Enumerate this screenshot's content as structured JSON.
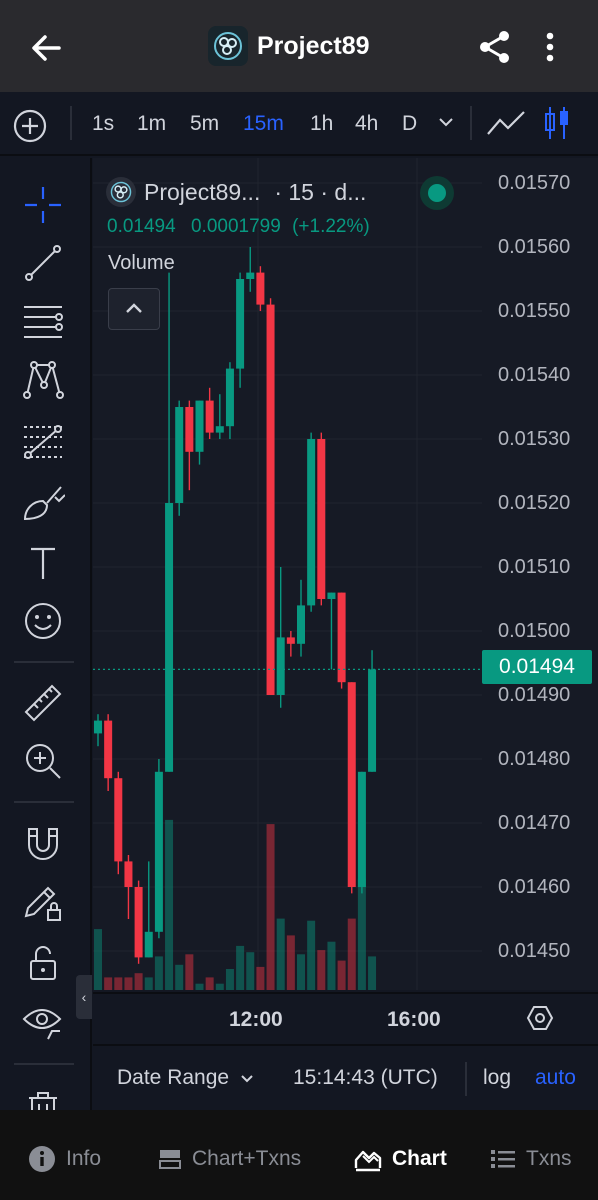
{
  "header": {
    "title": "Project89",
    "back_icon": "arrow-left-icon",
    "share_icon": "share-icon",
    "more_icon": "more-vertical-icon"
  },
  "timeframes": {
    "items": [
      "1s",
      "1m",
      "5m",
      "15m",
      "1h",
      "4h",
      "D"
    ],
    "active": "15m"
  },
  "legend": {
    "symbol": "Project89...",
    "meta": "· 15 · d...",
    "price": "0.01494",
    "change": "0.0001799",
    "change_pct": "(+1.22%)",
    "volume_label": "Volume"
  },
  "price_scale": {
    "labels": [
      "0.01570",
      "0.01560",
      "0.01550",
      "0.01540",
      "0.01530",
      "0.01520",
      "0.01510",
      "0.01500",
      "0.01490",
      "0.01480",
      "0.01470",
      "0.01460",
      "0.01450"
    ],
    "current": "0.01494"
  },
  "time_axis": {
    "labels": [
      "12:00",
      "16:00"
    ]
  },
  "range_bar": {
    "date_range": "Date Range",
    "clock": "15:14:43 (UTC)",
    "log": "log",
    "auto": "auto"
  },
  "bottom_nav": {
    "items": [
      {
        "label": "Info",
        "icon": "info-icon"
      },
      {
        "label": "Chart+Txns",
        "icon": "split-view-icon"
      },
      {
        "label": "Chart",
        "icon": "area-chart-icon"
      },
      {
        "label": "Txns",
        "icon": "list-icon"
      }
    ],
    "active": "Chart"
  },
  "colors": {
    "up": "#089981",
    "down": "#f23645",
    "accent": "#2962ff",
    "background": "#131722"
  },
  "chart_data": {
    "type": "candlestick",
    "ylim": [
      0.0144,
      0.01575
    ],
    "candles": [
      {
        "o": 0.01484,
        "h": 0.01487,
        "l": 0.01482,
        "c": 0.01486
      },
      {
        "o": 0.01486,
        "h": 0.01487,
        "l": 0.01475,
        "c": 0.01477
      },
      {
        "o": 0.01477,
        "h": 0.01478,
        "l": 0.01462,
        "c": 0.01464
      },
      {
        "o": 0.01464,
        "h": 0.01465,
        "l": 0.01455,
        "c": 0.0146
      },
      {
        "o": 0.0146,
        "h": 0.01461,
        "l": 0.01448,
        "c": 0.01449
      },
      {
        "o": 0.01449,
        "h": 0.01464,
        "l": 0.01449,
        "c": 0.01453
      },
      {
        "o": 0.01453,
        "h": 0.0148,
        "l": 0.01452,
        "c": 0.01478
      },
      {
        "o": 0.01478,
        "h": 0.01556,
        "l": 0.01478,
        "c": 0.0152
      },
      {
        "o": 0.0152,
        "h": 0.01536,
        "l": 0.01518,
        "c": 0.01535
      },
      {
        "o": 0.01535,
        "h": 0.01536,
        "l": 0.01522,
        "c": 0.01528
      },
      {
        "o": 0.01528,
        "h": 0.01536,
        "l": 0.01526,
        "c": 0.01536
      },
      {
        "o": 0.01536,
        "h": 0.01538,
        "l": 0.0153,
        "c": 0.01531
      },
      {
        "o": 0.01531,
        "h": 0.01537,
        "l": 0.0153,
        "c": 0.01532
      },
      {
        "o": 0.01532,
        "h": 0.01542,
        "l": 0.0153,
        "c": 0.01541
      },
      {
        "o": 0.01541,
        "h": 0.01556,
        "l": 0.01538,
        "c": 0.01555
      },
      {
        "o": 0.01555,
        "h": 0.0156,
        "l": 0.01553,
        "c": 0.01556
      },
      {
        "o": 0.01556,
        "h": 0.01557,
        "l": 0.0155,
        "c": 0.01551
      },
      {
        "o": 0.01551,
        "h": 0.01552,
        "l": 0.0149,
        "c": 0.0149
      },
      {
        "o": 0.0149,
        "h": 0.0151,
        "l": 0.01488,
        "c": 0.01499
      },
      {
        "o": 0.01499,
        "h": 0.015,
        "l": 0.01496,
        "c": 0.01498
      },
      {
        "o": 0.01498,
        "h": 0.01508,
        "l": 0.01496,
        "c": 0.01504
      },
      {
        "o": 0.01504,
        "h": 0.01531,
        "l": 0.01503,
        "c": 0.0153
      },
      {
        "o": 0.0153,
        "h": 0.01531,
        "l": 0.01504,
        "c": 0.01505
      },
      {
        "o": 0.01505,
        "h": 0.01506,
        "l": 0.01494,
        "c": 0.01506
      },
      {
        "o": 0.01506,
        "h": 0.01506,
        "l": 0.01491,
        "c": 0.01492
      },
      {
        "o": 0.01492,
        "h": 0.01492,
        "l": 0.01459,
        "c": 0.0146
      },
      {
        "o": 0.0146,
        "h": 0.01478,
        "l": 0.01459,
        "c": 0.01478
      },
      {
        "o": 0.01478,
        "h": 0.01497,
        "l": 0.01478,
        "c": 0.01494
      }
    ],
    "volumes": [
      0.29,
      0.06,
      0.06,
      0.06,
      0.08,
      0.06,
      0.16,
      0.81,
      0.12,
      0.17,
      0.03,
      0.06,
      0.03,
      0.1,
      0.21,
      0.18,
      0.11,
      0.79,
      0.34,
      0.26,
      0.17,
      0.33,
      0.19,
      0.23,
      0.14,
      0.34,
      0.53,
      0.16
    ]
  }
}
